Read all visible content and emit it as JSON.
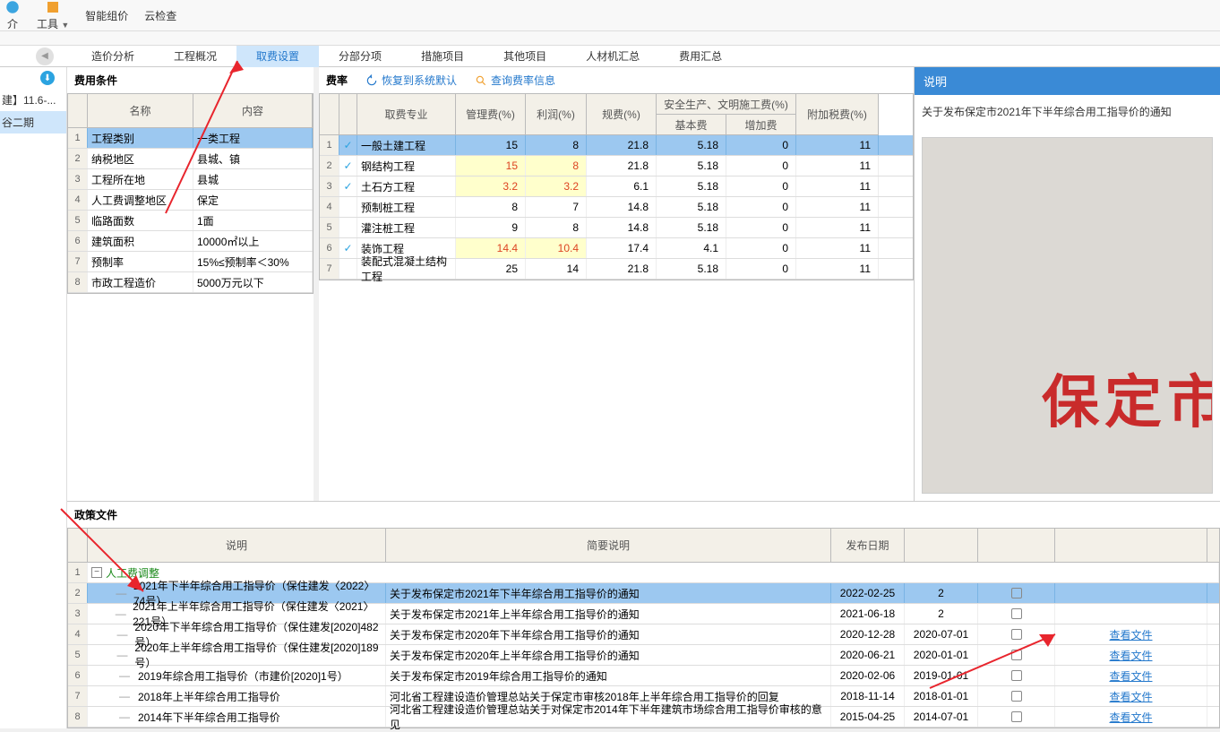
{
  "top_tools": [
    "介",
    "工具",
    "智能组价",
    "云检查"
  ],
  "nav_tabs": [
    "造价分析",
    "工程概况",
    "取费设置",
    "分部分项",
    "措施项目",
    "其他项目",
    "人材机汇总",
    "费用汇总"
  ],
  "left": {
    "proj1": "建】11.6-...",
    "proj2": "谷二期"
  },
  "cond": {
    "title": "费用条件",
    "headers": [
      "名称",
      "内容"
    ],
    "rows": [
      {
        "n": "1",
        "name": "工程类别",
        "val": "一类工程"
      },
      {
        "n": "2",
        "name": "纳税地区",
        "val": "县城、镇"
      },
      {
        "n": "3",
        "name": "工程所在地",
        "val": "县城"
      },
      {
        "n": "4",
        "name": "人工费调整地区",
        "val": "保定"
      },
      {
        "n": "5",
        "name": "临路面数",
        "val": "1面"
      },
      {
        "n": "6",
        "name": "建筑面积",
        "val": "10000㎡以上"
      },
      {
        "n": "7",
        "name": "预制率",
        "val": "15%≤预制率＜30%"
      },
      {
        "n": "8",
        "name": "市政工程造价",
        "val": "5000万元以下"
      }
    ]
  },
  "rate": {
    "title": "费率",
    "restore": "恢复到系统默认",
    "query": "查询费率信息",
    "headers": {
      "major": "取费专业",
      "mgmt": "管理费(%)",
      "profit": "利润(%)",
      "gui": "规费(%)",
      "safe": "安全生产、文明施工费(%)",
      "base": "基本费",
      "add": "增加费",
      "tax": "附加税费(%)"
    },
    "rows": [
      {
        "n": "1",
        "chk": true,
        "name": "一般土建工程",
        "mgmt": "15",
        "profit": "8",
        "gui": "21.8",
        "base": "5.18",
        "add": "0",
        "tax": "11",
        "sel": true
      },
      {
        "n": "2",
        "chk": true,
        "name": "钢结构工程",
        "mgmt": "15",
        "profit": "8",
        "gui": "21.8",
        "base": "5.18",
        "add": "0",
        "tax": "11",
        "rd": true,
        "yl": true
      },
      {
        "n": "3",
        "chk": true,
        "name": "土石方工程",
        "mgmt": "3.2",
        "profit": "3.2",
        "gui": "6.1",
        "base": "5.18",
        "add": "0",
        "tax": "11",
        "rd": true,
        "yl": true
      },
      {
        "n": "4",
        "chk": false,
        "name": "预制桩工程",
        "mgmt": "8",
        "profit": "7",
        "gui": "14.8",
        "base": "5.18",
        "add": "0",
        "tax": "11"
      },
      {
        "n": "5",
        "chk": false,
        "name": "灌注桩工程",
        "mgmt": "9",
        "profit": "8",
        "gui": "14.8",
        "base": "5.18",
        "add": "0",
        "tax": "11"
      },
      {
        "n": "6",
        "chk": true,
        "name": "装饰工程",
        "mgmt": "14.4",
        "profit": "10.4",
        "gui": "17.4",
        "base": "4.1",
        "add": "0",
        "tax": "11",
        "rd": true,
        "yl": true
      },
      {
        "n": "7",
        "chk": false,
        "name": "装配式混凝土结构工程",
        "mgmt": "25",
        "profit": "14",
        "gui": "21.8",
        "base": "5.18",
        "add": "0",
        "tax": "11"
      }
    ]
  },
  "right": {
    "title": "说明",
    "text": "关于发布保定市2021年下半年综合用工指导价的通知",
    "big": "保定市"
  },
  "docs": {
    "title": "政策文件",
    "headers": {
      "desc": "说明",
      "brief": "简要说明",
      "pub": "发布日期",
      "eff": "",
      "chk": "",
      "view": ""
    },
    "group": "人工费调整",
    "rows": [
      {
        "n": "2",
        "desc": "2021年下半年综合用工指导价（保住建发〈2022〉74号）",
        "brief": "关于发布保定市2021年下半年综合用工指导价的通知",
        "pub": "2022-02-25",
        "eff": "2",
        "chk": false,
        "view": "",
        "sel": true
      },
      {
        "n": "3",
        "desc": "2021年上半年综合用工指导价（保住建发〈2021〉221号）",
        "brief": "关于发布保定市2021年上半年综合用工指导价的通知",
        "pub": "2021-06-18",
        "eff": "2",
        "chk": false,
        "view": ""
      },
      {
        "n": "4",
        "desc": "2020年下半年综合用工指导价（保住建发[2020]482号）",
        "brief": "关于发布保定市2020年下半年综合用工指导价的通知",
        "pub": "2020-12-28",
        "eff": "2020-07-01",
        "chk": false,
        "view": "查看文件"
      },
      {
        "n": "5",
        "desc": "2020年上半年综合用工指导价（保住建发[2020]189号）",
        "brief": "关于发布保定市2020年上半年综合用工指导价的通知",
        "pub": "2020-06-21",
        "eff": "2020-01-01",
        "chk": false,
        "view": "查看文件"
      },
      {
        "n": "6",
        "desc": "2019年综合用工指导价（市建价[2020]1号）",
        "brief": "关于发布保定市2019年综合用工指导价的通知",
        "pub": "2020-02-06",
        "eff": "2019-01-01",
        "chk": false,
        "view": "查看文件"
      },
      {
        "n": "7",
        "desc": "2018年上半年综合用工指导价",
        "brief": "河北省工程建设造价管理总站关于保定市审核2018年上半年综合用工指导价的回复",
        "pub": "2018-11-14",
        "eff": "2018-01-01",
        "chk": false,
        "view": "查看文件"
      },
      {
        "n": "8",
        "desc": "2014年下半年综合用工指导价",
        "brief": "河北省工程建设造价管理总站关于对保定市2014年下半年建筑市场综合用工指导价审核的意见",
        "pub": "2015-04-25",
        "eff": "2014-07-01",
        "chk": false,
        "view": "查看文件"
      }
    ]
  }
}
